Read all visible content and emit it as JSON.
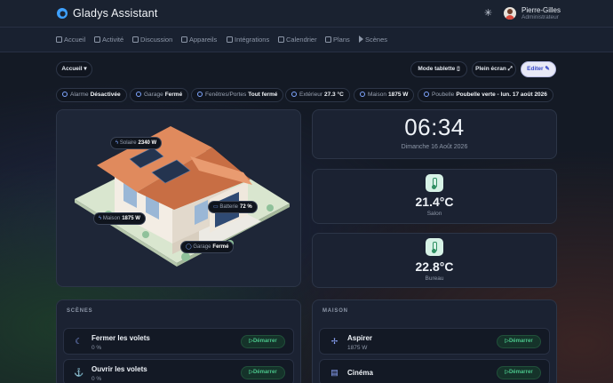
{
  "app": {
    "title": "Gladys Assistant"
  },
  "user": {
    "name": "Pierre-Gilles",
    "role": "Administrateur"
  },
  "nav": [
    {
      "label": "Accueil"
    },
    {
      "label": "Activité"
    },
    {
      "label": "Discussion"
    },
    {
      "label": "Appareils"
    },
    {
      "label": "Intégrations"
    },
    {
      "label": "Calendrier"
    },
    {
      "label": "Plans"
    },
    {
      "label": "Scènes"
    }
  ],
  "dashboard": {
    "selector_label": "Accueil"
  },
  "toolbar": {
    "tablet_label": "Mode tablette",
    "fullscreen_label": "Plein écran",
    "edit_label": "Editer"
  },
  "chips": [
    {
      "label": "Alarme",
      "value": "Désactivée"
    },
    {
      "label": "Garage",
      "value": "Fermé"
    },
    {
      "label": "Fenêtres/Portes",
      "value": "Tout fermé"
    },
    {
      "label": "Extérieur",
      "value": "27.3 °C"
    },
    {
      "label": "Maison",
      "value": "1875 W"
    },
    {
      "label": "Poubelle",
      "value": "Poubelle verte - lun. 17 août 2026"
    }
  ],
  "house_tags": {
    "solar": {
      "label": "Solaire",
      "value": "2340 W"
    },
    "battery": {
      "label": "Batterie",
      "value": "72 %"
    },
    "home": {
      "label": "Maison",
      "value": "1875 W"
    },
    "garage": {
      "label": "Garage",
      "value": "Fermé"
    }
  },
  "clock": {
    "time": "06:34",
    "date": "Dimanche 16 Août 2026"
  },
  "temps": [
    {
      "value": "21.4°C",
      "room": "Salon"
    },
    {
      "value": "22.8°C",
      "room": "Bureau"
    }
  ],
  "scenes": {
    "title": "SCÈNES",
    "items": [
      {
        "name": "Fermer les volets",
        "sub": "0 %",
        "action": "Démarrer"
      },
      {
        "name": "Ouvrir les volets",
        "sub": "0 %",
        "action": "Démarrer"
      }
    ]
  },
  "home": {
    "title": "MAISON",
    "items": [
      {
        "name": "Aspirer",
        "sub": "1875 W",
        "action": "Démarrer"
      },
      {
        "name": "Cinéma",
        "sub": "",
        "action": "Démarrer"
      }
    ]
  },
  "colors": {
    "accent": "#3949c8",
    "success": "#4ac48a",
    "roof": "#e08a5d"
  },
  "icons": {
    "logo": "gladys-logo",
    "theme": "sun-icon"
  }
}
